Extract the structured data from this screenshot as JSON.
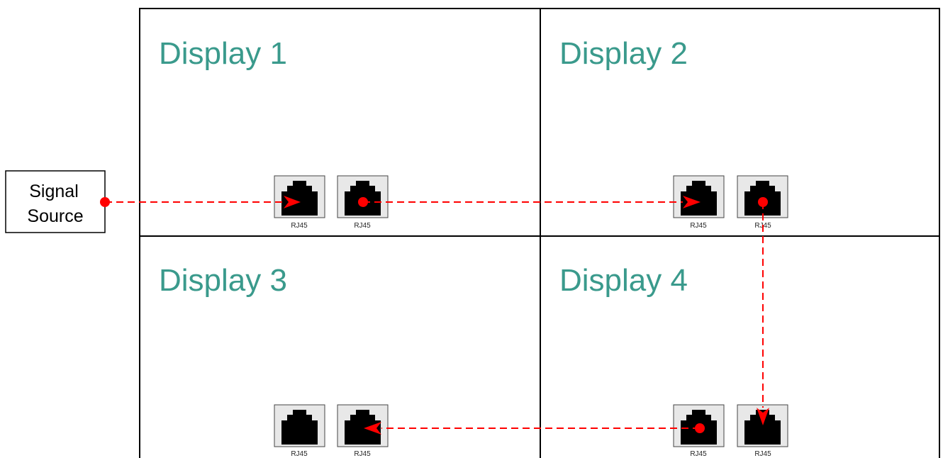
{
  "signal_source": {
    "line1": "Signal",
    "line2": "Source"
  },
  "displays": [
    {
      "title": "Display 1"
    },
    {
      "title": "Display 2"
    },
    {
      "title": "Display 3"
    },
    {
      "title": "Display 4"
    }
  ],
  "port_label": "RJ45",
  "icons": {
    "port": "rj45-port-icon",
    "connector": "red-dashed-cable"
  },
  "colors": {
    "title": "#3a9a8c",
    "cable": "#ff0000",
    "port_bg": "#e8e8e8",
    "port_fill": "#000000"
  }
}
